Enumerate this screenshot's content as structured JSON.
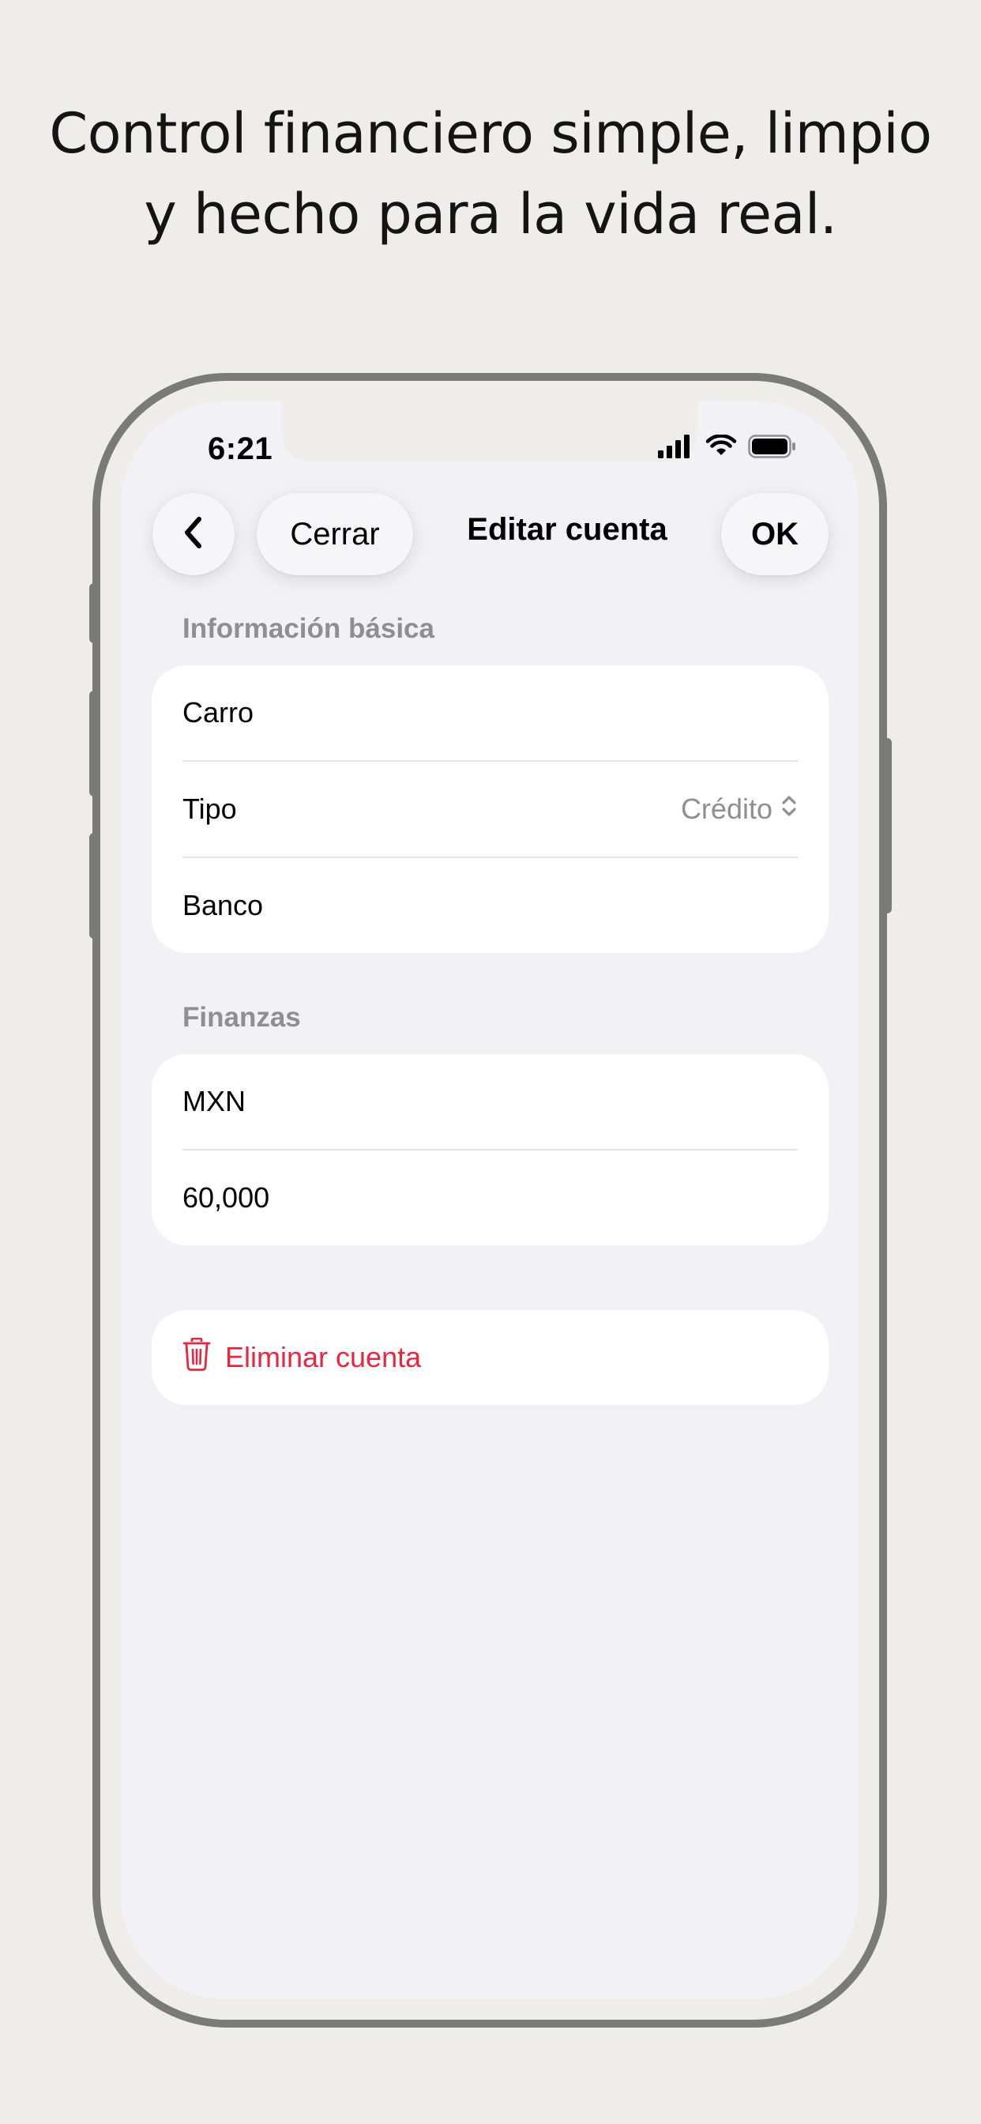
{
  "headline": {
    "line1": "Control financiero simple, limpio",
    "line2": "y hecho para la vida real."
  },
  "status_bar": {
    "time": "6:21",
    "icons": [
      "cellular-signal-icon",
      "wifi-icon",
      "battery-icon"
    ]
  },
  "nav": {
    "back_icon": "chevron-left-icon",
    "close_label": "Cerrar",
    "title": "Editar cuenta",
    "ok_label": "OK"
  },
  "sections": [
    {
      "header": "Información básica",
      "rows": [
        {
          "label": "Carro"
        },
        {
          "label": "Tipo",
          "value": "Crédito",
          "icon": "chevron-up-down-icon"
        },
        {
          "label": "Banco"
        }
      ]
    },
    {
      "header": "Finanzas",
      "rows": [
        {
          "label": "MXN"
        },
        {
          "label": "60,000"
        }
      ]
    }
  ],
  "delete": {
    "label": "Eliminar cuenta",
    "icon": "trash-icon"
  },
  "colors": {
    "background": "#eeede9",
    "screen": "#f1f1f6",
    "frame": "#7a7a78",
    "secondary_text": "#8e8e93",
    "destructive": "#e8263f"
  }
}
